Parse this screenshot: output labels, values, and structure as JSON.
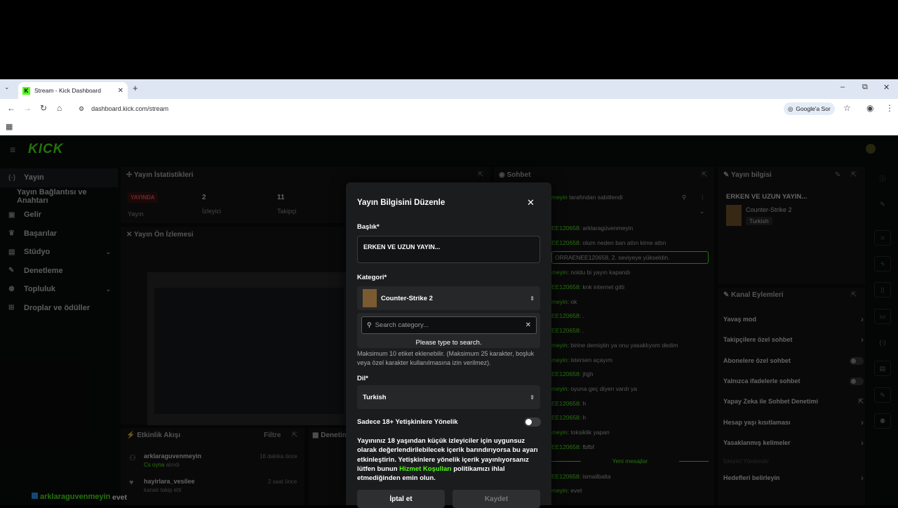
{
  "browser": {
    "tab_title": "Stream - Kick Dashboard",
    "favicon_letter": "K",
    "url": "dashboard.kick.com/stream",
    "google_lens_label": "Google'a Sor"
  },
  "app": {
    "logo": "KICK"
  },
  "sidebar": {
    "items": [
      {
        "label": "Yayın",
        "icon": "broadcast-icon"
      },
      {
        "label": "Yayın Bağlantısı ve Anahtarı",
        "icon": ""
      },
      {
        "label": "Gelir",
        "icon": "revenue-icon"
      },
      {
        "label": "Başarılar",
        "icon": "trophy-icon"
      },
      {
        "label": "Stüdyo",
        "icon": "studio-icon"
      },
      {
        "label": "Denetleme",
        "icon": "wrench-icon"
      },
      {
        "label": "Topluluk",
        "icon": "people-icon"
      },
      {
        "label": "Droplar ve ödüller",
        "icon": "gift-icon"
      }
    ]
  },
  "stats": {
    "title": "Yayın İstatistikleri",
    "live_badge": "YAYINDA",
    "live_label": "Yayın",
    "viewers_value": "2",
    "viewers_label": "İzleyici",
    "followers_value": "11",
    "followers_label": "Takipçi"
  },
  "preview": {
    "title": "Yayın Ön İzlemesi"
  },
  "chat": {
    "title": "Sohbet",
    "pinned": "tarafından sabitlendi",
    "lines": [
      {
        "user": "EE120658",
        "text": ": arklaragüvenmeyin"
      },
      {
        "user": "EE120658",
        "text": ": olum neden ban attın kime attın"
      },
      {
        "user": "meyin",
        "text": ": noldu bi yayın kapandı"
      },
      {
        "user": "EE120658",
        "text": ": knk internet gitti"
      },
      {
        "user": "meyin",
        "text": ": ok"
      },
      {
        "user": "EE120658",
        "text": ": ."
      },
      {
        "user": "EE120658",
        "text": ": ."
      },
      {
        "user": "meyin",
        "text": ": birine demiştin ya onu yasaklıyom dedim"
      },
      {
        "user": "meyin",
        "text": ": istersen açayım"
      },
      {
        "user": "EE120658",
        "text": ": jhjjh"
      },
      {
        "user": "meyin",
        "text": ": oyuna geç diyen vardı ya"
      },
      {
        "user": "EE120658",
        "text": ": h"
      },
      {
        "user": "EE120658",
        "text": ": h"
      },
      {
        "user": "meyin",
        "text": ": toksiklik yapan"
      },
      {
        "user": "EE120658",
        "text": ": fbfbf"
      },
      {
        "user": "EE120658",
        "text": ": ismailbalta"
      },
      {
        "user": "meyin",
        "text": ": evet"
      }
    ],
    "system_msg": "ORRAENEE120658, 2. seviyeye yükseldin.",
    "new_messages": "Yeni mesajlar"
  },
  "stream_info": {
    "title": "Yayın bilgisi",
    "stream_title": "ERKEN VE UZUN YAYIN...",
    "category": "Counter-Strike 2",
    "language": "Turkish"
  },
  "channel_actions": {
    "title": "Kanal Eylemleri",
    "items": [
      {
        "label": "Yavaş mod",
        "kind": "chevron"
      },
      {
        "label": "Takipçilere özel sohbet",
        "kind": "chevron"
      },
      {
        "label": "Abonelere özel sohbet",
        "kind": "toggle"
      },
      {
        "label": "Yalnızca ifadelerle sohbet",
        "kind": "toggle"
      },
      {
        "label": "Yapay Zeka ile Sohbet Denetimi",
        "kind": "external"
      },
      {
        "label": "Hesap yaşı kısıtlaması",
        "kind": "chevron"
      },
      {
        "label": "Yasaklanmış kelimeler",
        "kind": "chevron"
      },
      {
        "label": "Hedefleri belirleyin",
        "kind": "chevron"
      }
    ],
    "faded": "İzleyici Yönlendir"
  },
  "activity": {
    "title": "Etkinlik Akışı",
    "filter": "Filtre",
    "events": [
      {
        "name": "arklaraguvenmeyin",
        "sub_prefix": "",
        "sub_link": "Cs oyna",
        "sub_suffix": " alındı",
        "time": "16 dakika önce"
      },
      {
        "name": "hayirlara_vesilee",
        "sub_prefix": "kanalı takip etti",
        "sub_link": "",
        "sub_suffix": "",
        "time": "2 saat önce"
      }
    ]
  },
  "mod_panel": {
    "title": "Denetim"
  },
  "overlay": {
    "user": "arklaraguvenmeyin",
    "msg": "evet"
  },
  "modal": {
    "title": "Yayın Bilgisini Düzenle",
    "title_label": "Başlık*",
    "title_value": "ERKEN VE UZUN YAYIN...",
    "category_label": "Kategori*",
    "category_value": "Counter-Strike 2",
    "search_placeholder": "Search category...",
    "search_hint": "Please type to search.",
    "tags_note": "Maksimum 10 etiket eklenebilir. (Maksimum 25 karakter, boşluk veya özel karakter kullanılmasına izin verilmez).",
    "language_label": "Dil*",
    "language_value": "Turkish",
    "adult_label": "Sadece 18+ Yetişkinlere Yönelik",
    "warning_part1": "Yayınınız 18 yaşından küçük izleyiciler için uygunsuz olarak değerlendirilebilecek içerik barındırıyorsa bu ayarı etkinleştirin. Yetişkinlere yönelik içerik yayınlıyorsanız lütfen bunun ",
    "warning_link": "Hizmet Koşulları",
    "warning_part2": " politikamızı ihlal etmediğinden emin olun.",
    "cancel": "İptal et",
    "save": "Kaydet"
  }
}
